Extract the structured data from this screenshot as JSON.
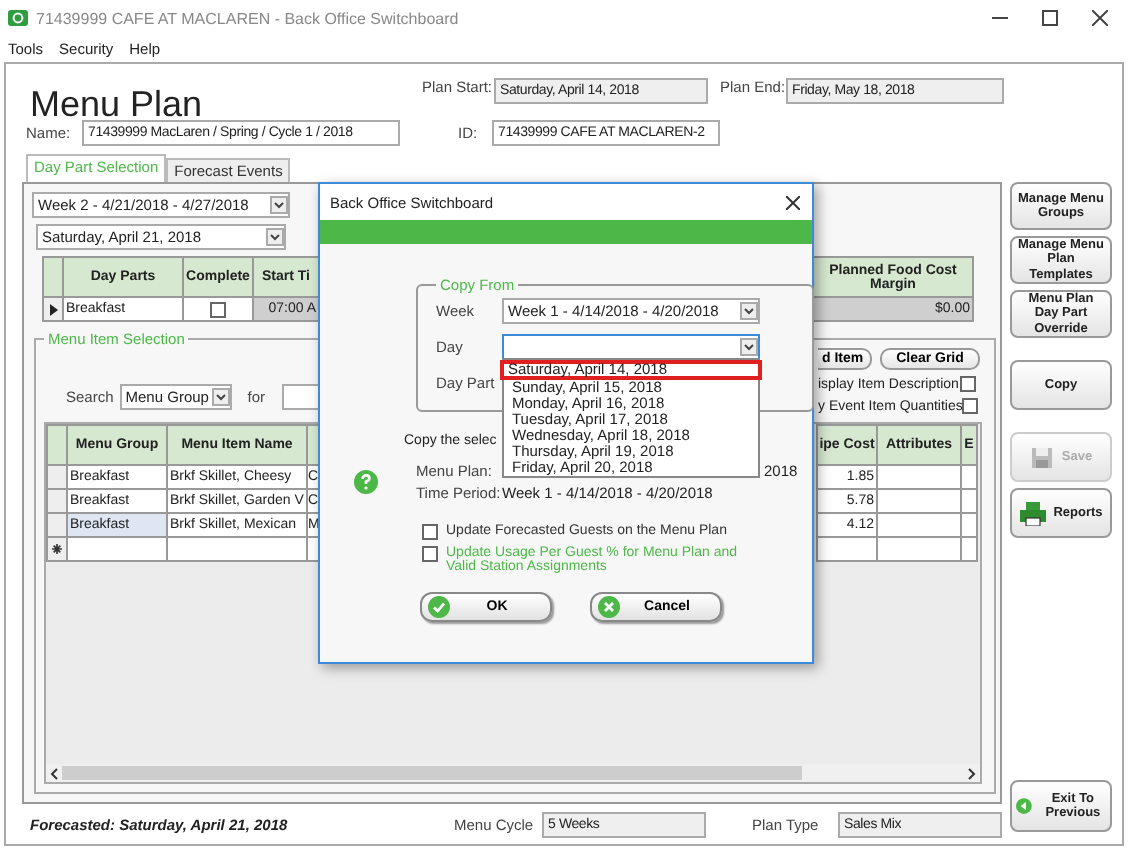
{
  "window": {
    "title": "71439999 CAFE AT MACLAREN - Back Office Switchboard"
  },
  "menu_bar": [
    "Tools",
    "Security",
    "Help"
  ],
  "header": {
    "title": "Menu Plan",
    "plan_start_label": "Plan Start:",
    "plan_start": "Saturday, April 14, 2018",
    "plan_end_label": "Plan End:",
    "plan_end": "Friday, May 18, 2018",
    "name_label": "Name:",
    "name": "71439999 MacLaren / Spring / Cycle 1 / 2018",
    "id_label": "ID:",
    "id": "71439999 CAFE AT MACLAREN-2"
  },
  "tabs": [
    {
      "label": "Day Part Selection",
      "selected": true
    },
    {
      "label": "Forecast Events",
      "selected": false
    }
  ],
  "week_select": "Week 2 - 4/21/2018 - 4/27/2018",
  "day_select": "Saturday, April 21, 2018",
  "day_parts": {
    "columns": [
      "Day Parts",
      "Complete",
      "Start Ti",
      "Planned Food Cost Margin"
    ],
    "rows": [
      {
        "day_part": "Breakfast",
        "complete": false,
        "start_time": "07:00 A",
        "margin": "$0.00",
        "current": true
      }
    ]
  },
  "menu_item_selection": {
    "title": "Menu Item Selection",
    "search_label": "Search",
    "search_by": "Menu Group",
    "for_label": "for",
    "buttons": [
      "d Item",
      "Clear Grid"
    ],
    "options": [
      {
        "label": "isplay Item Description",
        "checked": false
      },
      {
        "label": "y Event Item Quantities",
        "checked": false
      }
    ],
    "columns": [
      "Menu Group",
      "Menu Item Name",
      "ipe Cost",
      "Attributes",
      "E"
    ],
    "rows": [
      {
        "kind": "item",
        "group": "Breakfast",
        "item": "Brkf Skillet, Cheesy",
        "column_3": "C",
        "column_4": "1.85",
        "selected": false
      },
      {
        "kind": "item",
        "group": "Breakfast",
        "item": "Brkf Skillet, Garden V",
        "column_3": "C",
        "column_4": "5.78",
        "selected": false
      },
      {
        "kind": "item",
        "group": "Breakfast",
        "item": "Brkf Skillet, Mexican",
        "column_3": "M",
        "column_4": "4.12",
        "selected": true
      },
      {
        "kind": "new",
        "selected": false
      }
    ]
  },
  "footer": {
    "forecasted": "Forecasted: Saturday, April 21, 2018",
    "menu_cycle_label": "Menu Cycle",
    "menu_cycle": "5 Weeks",
    "plan_type_label": "Plan Type",
    "plan_type": "Sales Mix"
  },
  "side_buttons": [
    {
      "label": "Manage Menu Groups",
      "kind": "text",
      "disabled": false
    },
    {
      "label": "Manage Menu Plan Templates",
      "kind": "text",
      "disabled": false
    },
    {
      "label": "Menu Plan Day Part Override",
      "kind": "text",
      "disabled": false
    },
    {
      "label": "Copy",
      "kind": "copy",
      "disabled": false
    },
    {
      "label": "Save",
      "kind": "save",
      "disabled": true
    },
    {
      "label": "Reports",
      "kind": "reports",
      "disabled": false
    },
    {
      "label": "Exit To Previous",
      "kind": "exit",
      "disabled": false
    }
  ],
  "dialog": {
    "title": "Back Office Switchboard",
    "group_title": "Copy From",
    "week_label": "Week",
    "week": "Week 1 - 4/14/2018 - 4/20/2018",
    "day_label": "Day",
    "day_part_label": "Day Part",
    "day_options": [
      {
        "label": "Saturday, April 14, 2018",
        "selected": true
      },
      {
        "label": "Sunday, April 15, 2018",
        "selected": false
      },
      {
        "label": "Monday, April 16, 2018",
        "selected": false
      },
      {
        "label": "Tuesday, April 17, 2018",
        "selected": false
      },
      {
        "label": "Wednesday, April 18, 2018",
        "selected": false
      },
      {
        "label": "Thursday, April 19, 2018",
        "selected": false
      },
      {
        "label": "Friday, April 20, 2018",
        "selected": false
      }
    ],
    "prompt": "Copy the selec",
    "menu_plan_label": "Menu Plan:",
    "menu_plan": "2018",
    "time_period_label": "Time Period:",
    "time_period": "Week 1 - 4/14/2018 - 4/20/2018",
    "options": [
      {
        "label": "Update Forecasted Guests on the Menu Plan",
        "checked": false,
        "kind": "plain"
      },
      {
        "label": "Update Usage Per Guest % for Menu Plan and Valid Station Assignments",
        "checked": false,
        "kind": "highlighted"
      }
    ],
    "buttons": [
      {
        "label": "OK",
        "kind": "ok"
      },
      {
        "label": "Cancel",
        "kind": "cancel"
      }
    ]
  }
}
